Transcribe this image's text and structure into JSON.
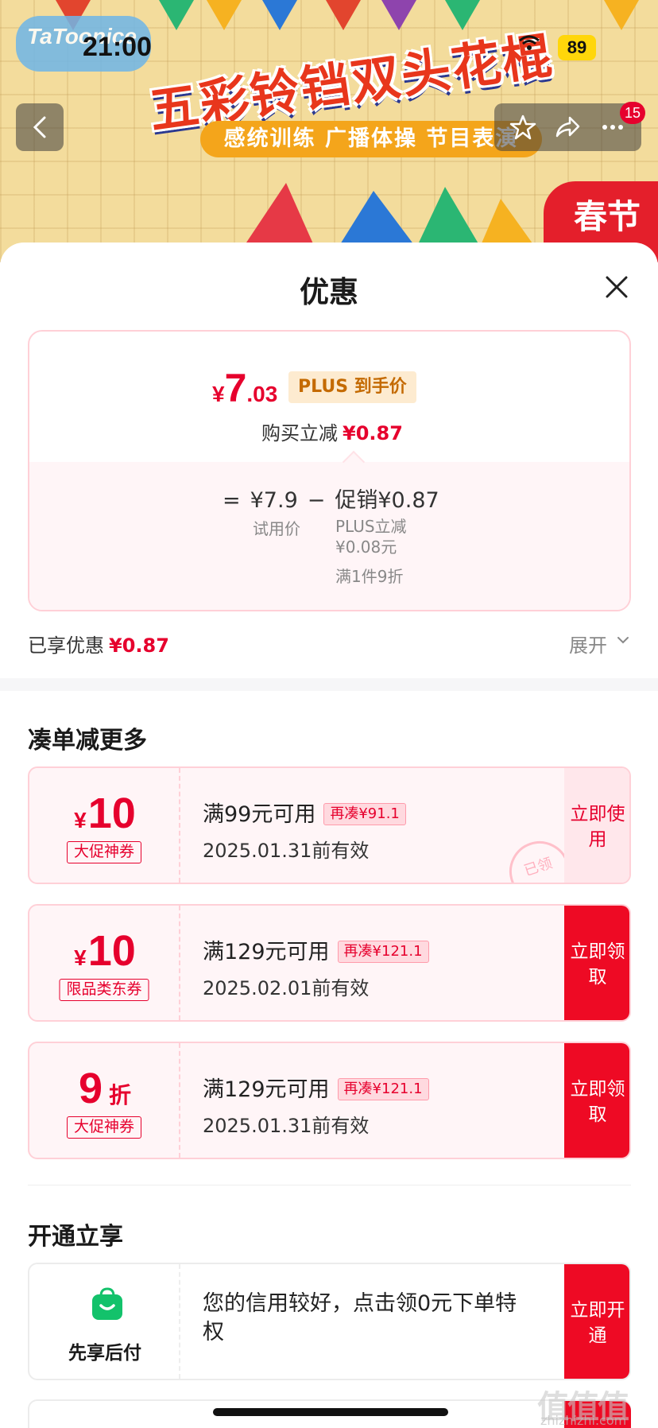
{
  "status_bar": {
    "time": "21:00",
    "battery": "89"
  },
  "banner": {
    "brand": "TaToonice",
    "title": "五彩铃铛双头花棍",
    "subtitle": "感统训练 广播体操 节目表演",
    "corner_promo": "春节",
    "message_count": "15"
  },
  "sheet": {
    "title": "优惠",
    "price": {
      "currency": "¥",
      "integer": "7",
      "decimal": ".03",
      "plus_tag": "PLUS 到手价",
      "buy_reduce_label": "购买立减",
      "buy_reduce_value": "¥0.87",
      "equals": "=",
      "trial_price": "¥7.9",
      "minus": "−",
      "promo_label": "促销¥0.87",
      "trial_label": "试用价",
      "plus_reduce": "PLUS立减¥0.08元",
      "discount_rule": "满1件9折"
    },
    "enjoyed_label": "已享优惠",
    "enjoyed_value": "¥0.87",
    "expand_label": "展开"
  },
  "bundle_section": {
    "title": "凑单减更多",
    "coupons": [
      {
        "currency": "¥",
        "amount": "10",
        "unit": "",
        "type": "大促神券",
        "condition": "满99元可用",
        "gap": "再凑¥91.1",
        "valid": "2025.01.31前有效",
        "action": "立即使用",
        "stamp": "已领"
      },
      {
        "currency": "¥",
        "amount": "10",
        "unit": "",
        "type": "限品类东券",
        "condition": "满129元可用",
        "gap": "再凑¥121.1",
        "valid": "2025.02.01前有效",
        "action": "立即领取"
      },
      {
        "currency": "",
        "amount": "9",
        "unit": "折",
        "type": "大促神券",
        "condition": "满129元可用",
        "gap": "再凑¥121.1",
        "valid": "2025.01.31前有效",
        "action": "立即领取"
      }
    ]
  },
  "open_section": {
    "title": "开通立享",
    "credit": {
      "name": "先享后付",
      "desc": "您的信用较好，点击领0元下单特权",
      "action": "立即开通"
    }
  },
  "watermark": {
    "main": "值值值",
    "sub": "zhizhizhi.com"
  },
  "colors": {
    "accent_red": "#e6002d",
    "action_red": "#ee0a24",
    "plus_gold": "#c46a00",
    "credit_green": "#13c26b"
  }
}
